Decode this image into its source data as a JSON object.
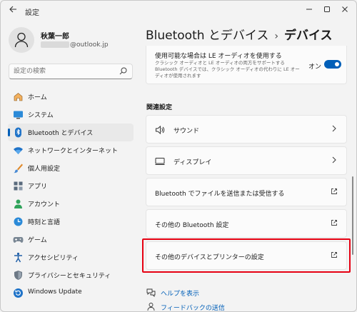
{
  "window": {
    "title": "設定"
  },
  "profile": {
    "name": "秋葉一郎",
    "email_visible": "@outlook.jp"
  },
  "search": {
    "placeholder": "設定の検索"
  },
  "sidebar": {
    "items": [
      {
        "label": "ホーム",
        "icon": "home-icon"
      },
      {
        "label": "システム",
        "icon": "system-icon"
      },
      {
        "label": "Bluetooth とデバイス",
        "icon": "bluetooth-icon",
        "active": true
      },
      {
        "label": "ネットワークとインターネット",
        "icon": "wifi-icon"
      },
      {
        "label": "個人用設定",
        "icon": "brush-icon"
      },
      {
        "label": "アプリ",
        "icon": "apps-icon"
      },
      {
        "label": "アカウント",
        "icon": "account-icon"
      },
      {
        "label": "時刻と言語",
        "icon": "time-language-icon"
      },
      {
        "label": "ゲーム",
        "icon": "gaming-icon"
      },
      {
        "label": "アクセシビリティ",
        "icon": "accessibility-icon"
      },
      {
        "label": "プライバシーとセキュリティ",
        "icon": "shield-icon"
      },
      {
        "label": "Windows Update",
        "icon": "windows-update-icon"
      }
    ]
  },
  "breadcrumb": {
    "parent": "Bluetooth とデバイス",
    "separator": "›",
    "current": "デバイス"
  },
  "le_audio": {
    "title": "使用可能な場合は LE オーディオを使用する",
    "description": "クラシック オーディオと LE オーディオの両方をサポートする Bluetooth デバイスでは、クラシック オーディオの代わりに LE オーディオが使用されます",
    "toggle_label": "オン",
    "toggle_on": true
  },
  "related": {
    "heading": "関連設定",
    "rows": [
      {
        "label": "サウンド"
      },
      {
        "label": "ディスプレイ"
      },
      {
        "label": "Bluetooth でファイルを送信または受信する"
      },
      {
        "label": "その他の Bluetooth 設定"
      },
      {
        "label": "その他のデバイスとプリンターの設定"
      }
    ]
  },
  "help": {
    "get_help": "ヘルプを表示",
    "feedback": "フィードバックの送信"
  },
  "colors": {
    "accent": "#005fb8",
    "highlight": "#e60012"
  }
}
